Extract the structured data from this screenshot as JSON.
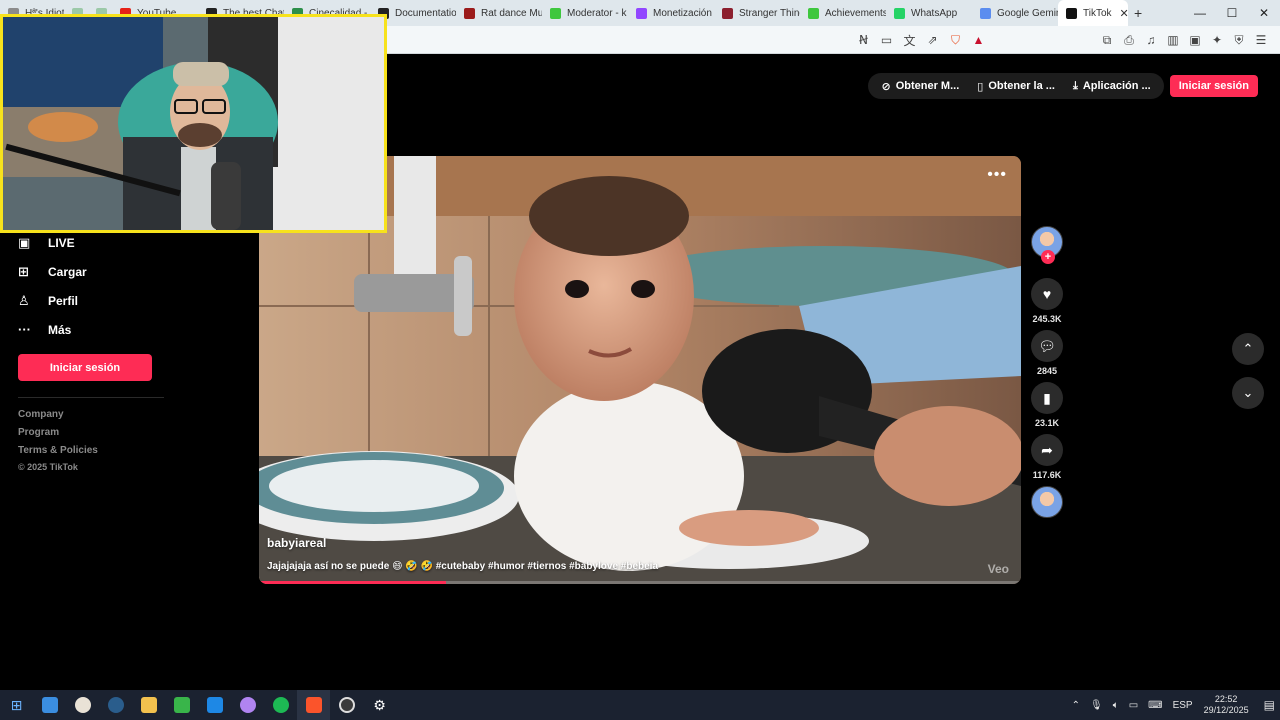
{
  "browser": {
    "tabs": [
      {
        "label": "Hª's Idiotas",
        "color": "#8b8b8b"
      },
      {
        "label": "",
        "color": "#9cc9a8"
      },
      {
        "label": "",
        "color": "#9cc9a8"
      },
      {
        "label": "YouTube",
        "color": "#e62117"
      },
      {
        "label": "The best Chat",
        "color": "#222222"
      },
      {
        "label": "Cinecalidad -",
        "color": "#2d8f4a"
      },
      {
        "label": "Documentatio",
        "color": "#222222"
      },
      {
        "label": "Rat dance Mu",
        "color": "#9b1b1b"
      },
      {
        "label": "Moderator - k",
        "color": "#3ec73e"
      },
      {
        "label": "Monetización",
        "color": "#9146ff"
      },
      {
        "label": "Stranger Thing",
        "color": "#8c1f2e"
      },
      {
        "label": "Achievements",
        "color": "#3ec73e"
      },
      {
        "label": "WhatsApp",
        "color": "#25d366"
      },
      {
        "label": "Google Gemini",
        "color": "#5b8def"
      },
      {
        "label": "TikTok",
        "color": "#111111"
      }
    ],
    "active_tab_close": "✕",
    "new_tab": "+",
    "window_controls": [
      "—",
      "☐",
      "✕"
    ]
  },
  "header": {
    "get_coins": "Obtener M...",
    "get_app": "Obtener la ...",
    "desktop_app": "Aplicación ...",
    "login": "Iniciar sesión"
  },
  "sidebar": {
    "items": [
      {
        "label": "LIVE",
        "icon": "live-icon"
      },
      {
        "label": "Cargar",
        "icon": "upload-icon"
      },
      {
        "label": "Perfil",
        "icon": "profile-icon"
      },
      {
        "label": "Más",
        "icon": "more-icon"
      }
    ],
    "login": "Iniciar sesión",
    "links": [
      "Company",
      "Program",
      "Terms & Policies"
    ],
    "copyright": "© 2025 TikTok"
  },
  "video": {
    "username": "babyiareal",
    "caption": "Jajajajaja así no se puede 😄 🤣 🤣 #cutebaby #humor #tiernos #babylove #bebeia",
    "watermark": "Veo",
    "progress": 0.245
  },
  "actions": {
    "likes": "245.3K",
    "comments": "2845",
    "saves": "23.1K",
    "shares": "117.6K"
  },
  "taskbar": {
    "language": "ESP",
    "time": "22:52",
    "date": "29/12/2025"
  }
}
